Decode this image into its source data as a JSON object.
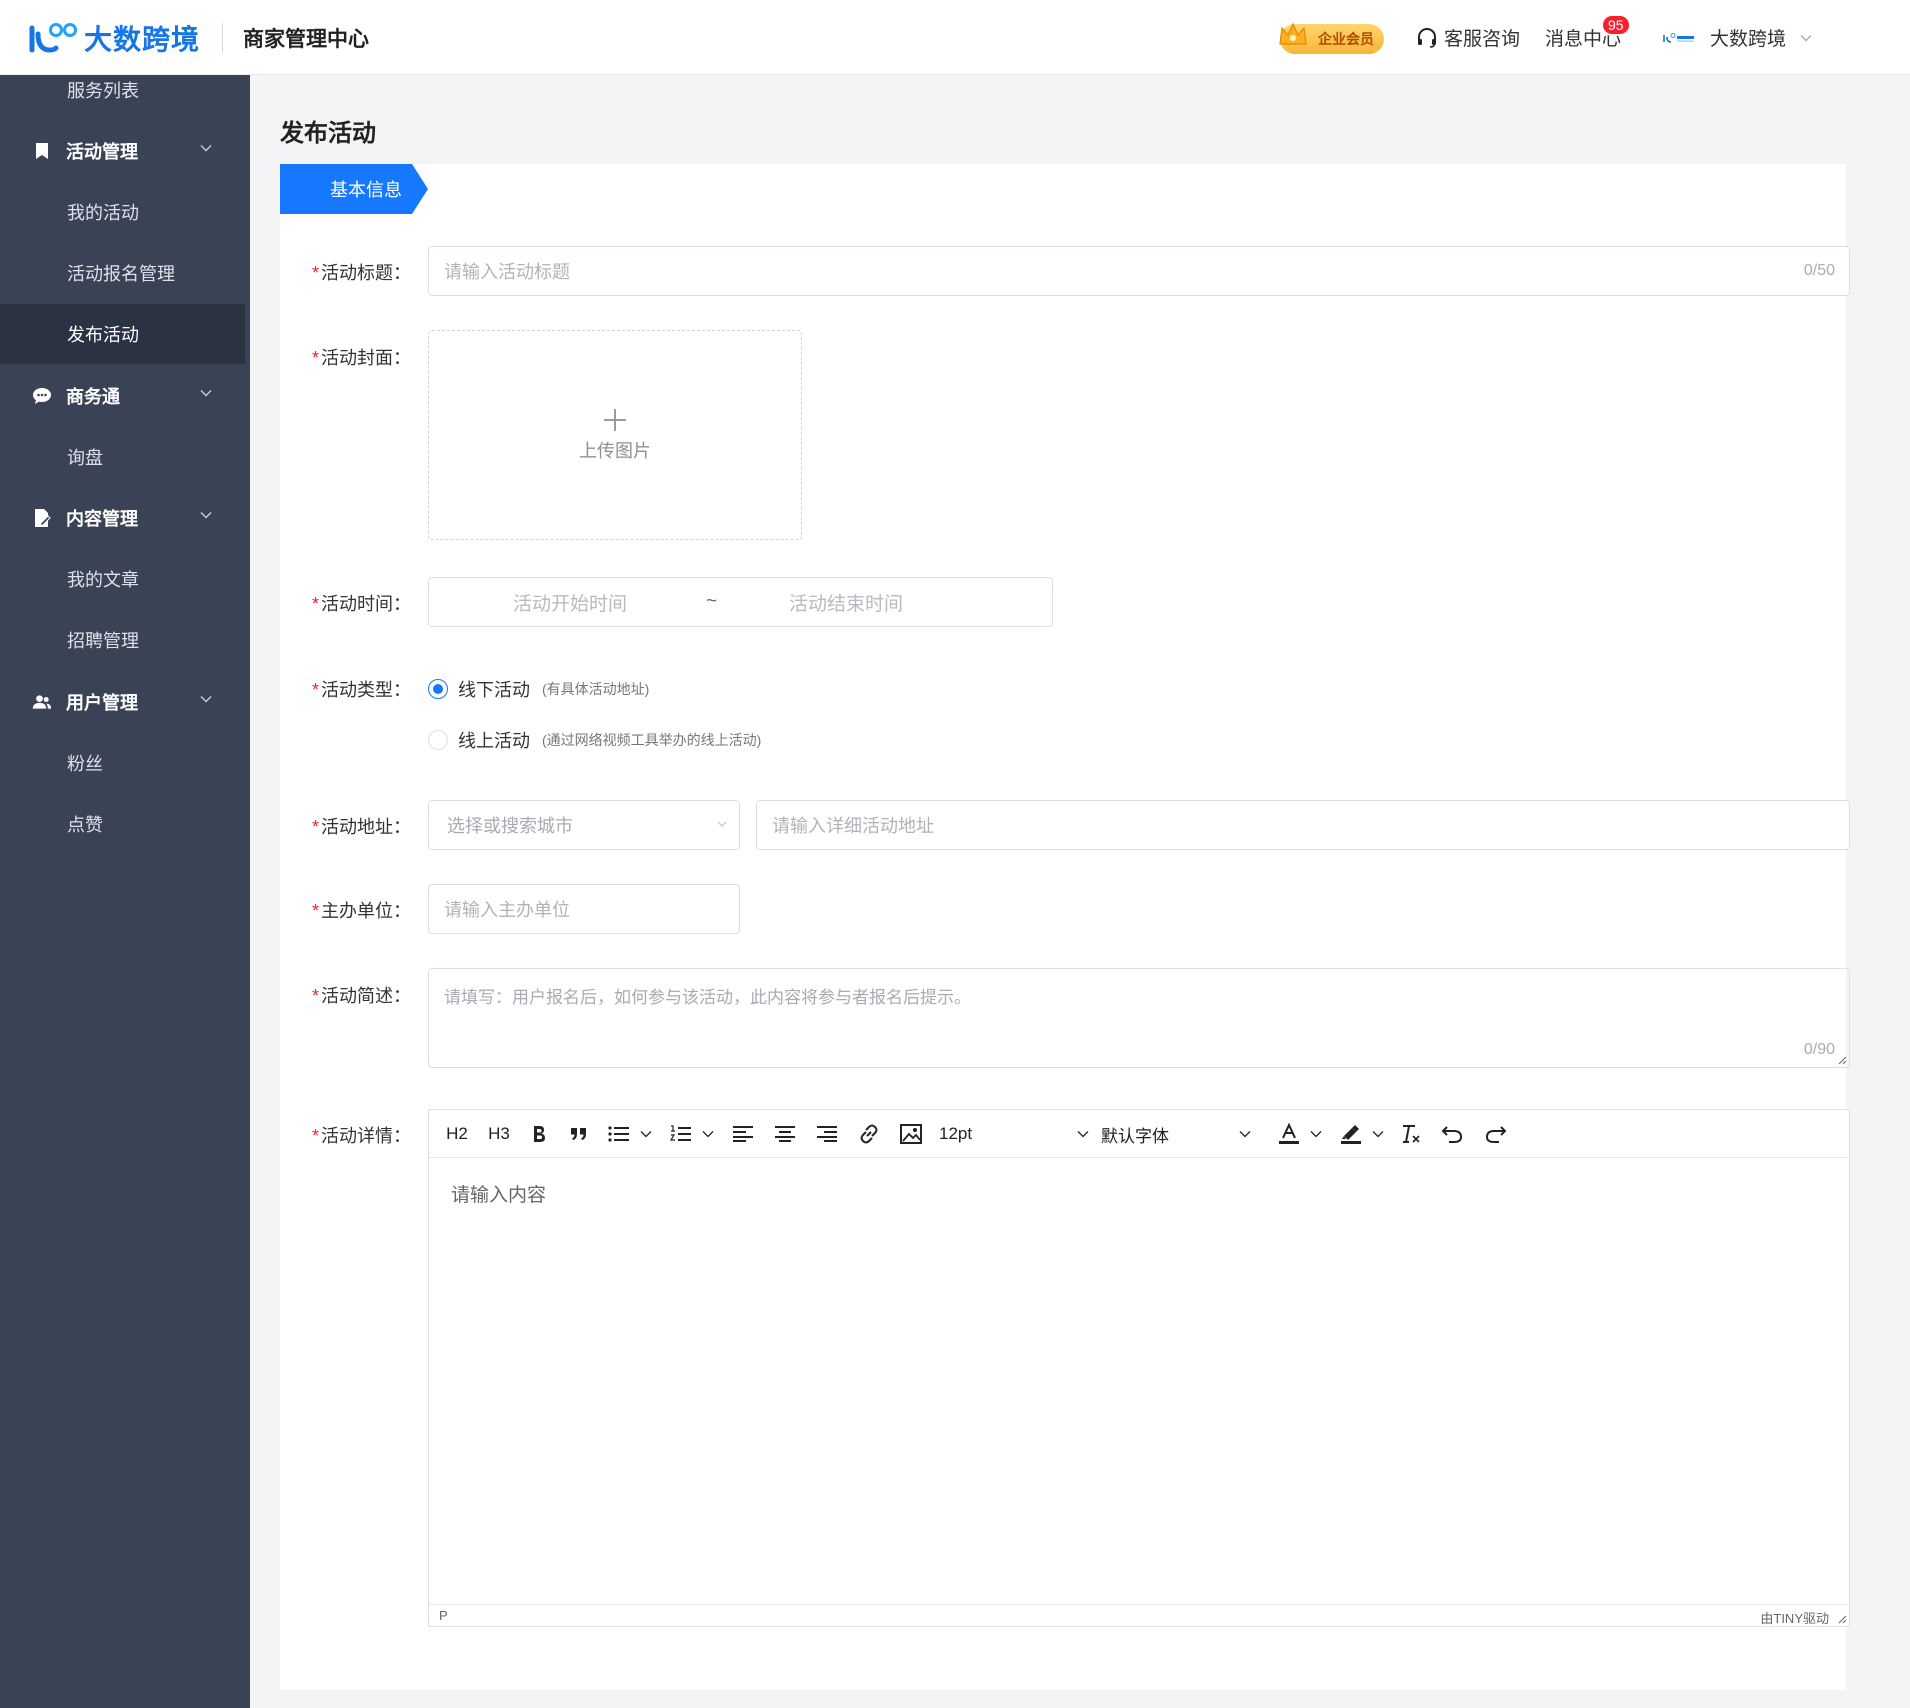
{
  "header": {
    "logo_text": "大数跨境",
    "logo_sub": "商家管理中心",
    "vip_label": "企业会员",
    "service_label": "客服咨询",
    "message_label": "消息中心",
    "message_count": "95",
    "user_name": "大数跨境",
    "brand_color": "#1677ff"
  },
  "sidebar": {
    "items": [
      {
        "label": "服务列表",
        "type": "sub"
      },
      {
        "label": "活动管理",
        "type": "group",
        "icon": "bookmark-icon"
      },
      {
        "label": "我的活动",
        "type": "sub"
      },
      {
        "label": "活动报名管理",
        "type": "sub"
      },
      {
        "label": "发布活动",
        "type": "sub",
        "active": true
      },
      {
        "label": "商务通",
        "type": "group",
        "icon": "chat-icon"
      },
      {
        "label": "询盘",
        "type": "sub"
      },
      {
        "label": "内容管理",
        "type": "group",
        "icon": "document-edit-icon"
      },
      {
        "label": "我的文章",
        "type": "sub"
      },
      {
        "label": "招聘管理",
        "type": "sub"
      },
      {
        "label": "用户管理",
        "type": "group",
        "icon": "users-icon"
      },
      {
        "label": "粉丝",
        "type": "sub"
      },
      {
        "label": "点赞",
        "type": "sub"
      }
    ]
  },
  "main": {
    "page_title": "发布活动",
    "tab_label": "基本信息",
    "form": {
      "title": {
        "label": "活动标题：",
        "placeholder": "请输入活动标题",
        "counter": "0/50"
      },
      "cover": {
        "label": "活动封面：",
        "upload_label": "上传图片"
      },
      "time": {
        "label": "活动时间：",
        "start_placeholder": "活动开始时间",
        "separator": "~",
        "end_placeholder": "活动结束时间"
      },
      "type": {
        "label": "活动类型：",
        "options": [
          {
            "label": "线下活动",
            "hint": "(有具体活动地址)",
            "checked": true
          },
          {
            "label": "线上活动",
            "hint": "(通过网络视频工具举办的线上活动)",
            "checked": false
          }
        ]
      },
      "address": {
        "label": "活动地址：",
        "city_placeholder": "选择或搜索城市",
        "detail_placeholder": "请输入详细活动地址"
      },
      "organizer": {
        "label": "主办单位：",
        "placeholder": "请输入主办单位"
      },
      "summary": {
        "label": "活动简述：",
        "placeholder": "请填写：用户报名后，如何参与该活动，此内容将参与者报名后提示。",
        "counter": "0/90"
      },
      "detail": {
        "label": "活动详情：",
        "toolbar": {
          "h2": "H2",
          "h3": "H3",
          "font_size": "12pt",
          "font_family": "默认字体"
        },
        "placeholder": "请输入内容",
        "status_path": "P",
        "status_brand": "由TINY驱动"
      }
    }
  }
}
